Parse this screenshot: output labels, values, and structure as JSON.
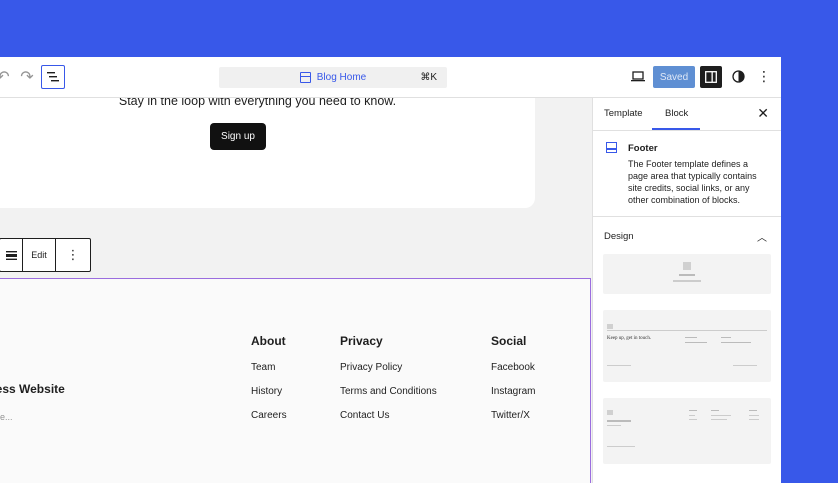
{
  "toolbar": {
    "command_title": "Blog Home",
    "shortcut": "⌘K",
    "saved_label": "Saved"
  },
  "canvas": {
    "signup_text": "Stay in the loop with everything you need to know.",
    "signup_button": "Sign up",
    "block_toolbar_edit": "Edit",
    "footer": {
      "site_title": "ress Website",
      "tagline": "line...",
      "columns": [
        {
          "heading": "About",
          "links": [
            "Team",
            "History",
            "Careers"
          ]
        },
        {
          "heading": "Privacy",
          "links": [
            "Privacy Policy",
            "Terms and Conditions",
            "Contact Us"
          ]
        },
        {
          "heading": "Social",
          "links": [
            "Facebook",
            "Instagram",
            "Twitter/X"
          ]
        }
      ]
    }
  },
  "sidebar": {
    "tabs": [
      "Template",
      "Block"
    ],
    "block_name": "Footer",
    "block_description": "The Footer template defines a page area that typically contains site credits, social links, or any other combination of blocks.",
    "design_label": "Design",
    "pattern2_tagline": "Keep up, get in touch."
  },
  "colors": {
    "accent": "#3858e9",
    "footer_outline": "#9b6ddf"
  }
}
